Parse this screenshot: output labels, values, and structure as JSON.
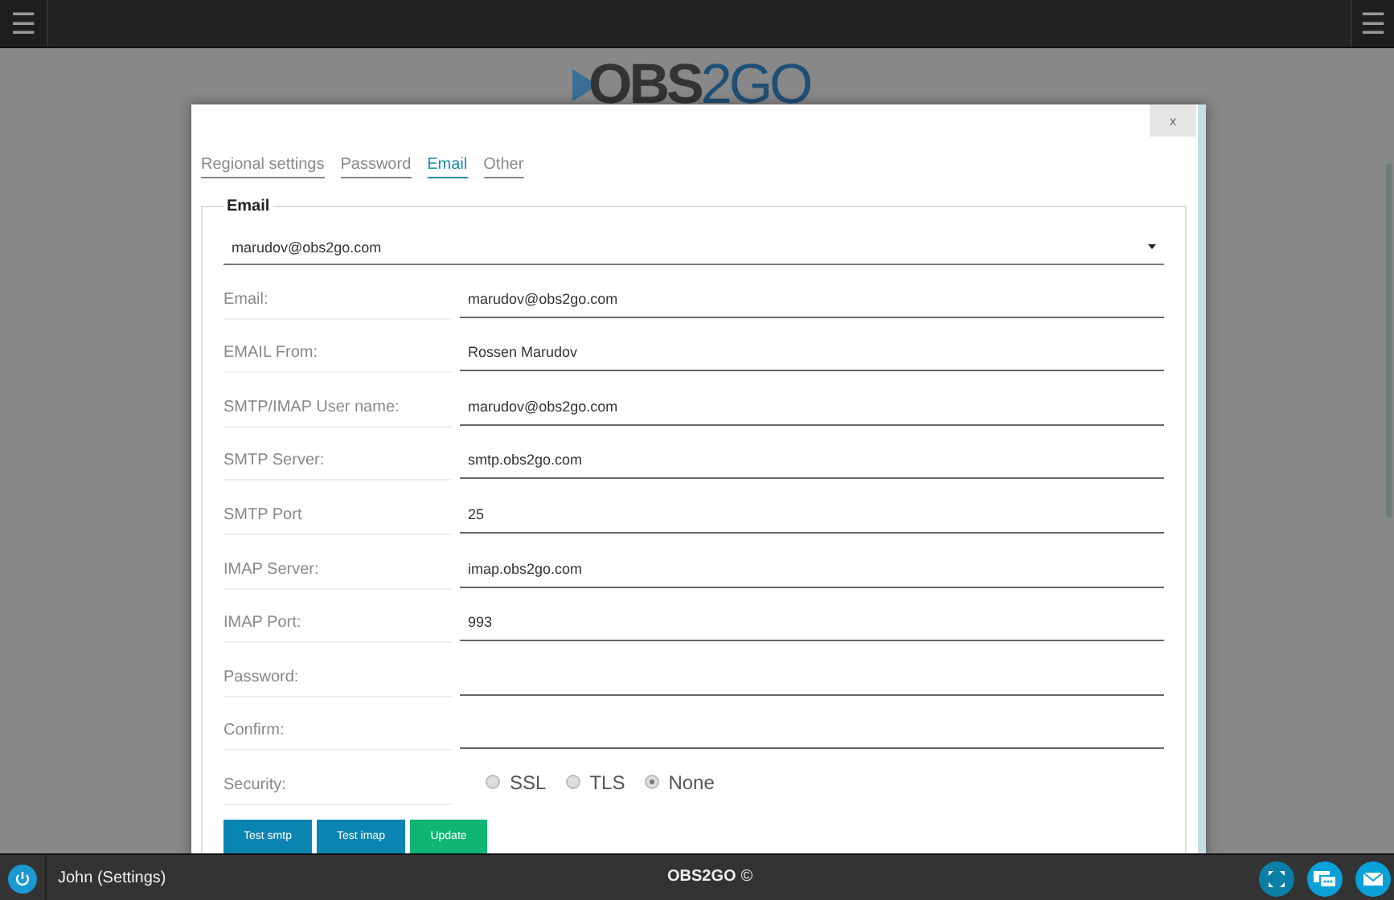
{
  "top_bar": {
    "menu_left": "☰",
    "menu_right": "☰"
  },
  "logo": {
    "part_1": "OBS",
    "part_2": "2GO"
  },
  "dialog": {
    "close": "x",
    "tabs": [
      {
        "label": "Regional settings",
        "selected": false
      },
      {
        "label": "Password",
        "selected": false
      },
      {
        "label": "Email",
        "selected": true
      },
      {
        "label": "Other",
        "selected": false
      }
    ],
    "section": "Email",
    "account_select": {
      "value": "marudov@obs2go.com"
    },
    "fields": [
      {
        "label": "Email:",
        "value": "marudov@obs2go.com"
      },
      {
        "label": "EMAIL From:",
        "value": "Rossen Marudov"
      },
      {
        "label": "SMTP/IMAP User name:",
        "value": "marudov@obs2go.com"
      },
      {
        "label": "SMTP Server:",
        "value": "smtp.obs2go.com"
      },
      {
        "label": "SMTP Port",
        "value": "25"
      },
      {
        "label": "IMAP Server:",
        "value": "imap.obs2go.com"
      },
      {
        "label": "IMAP Port:",
        "value": "993"
      },
      {
        "label": "Password:"
      },
      {
        "label": "Confirm:"
      }
    ],
    "security": {
      "label": "Security:",
      "options": [
        {
          "label": "SSL",
          "selected": false
        },
        {
          "label": "TLS",
          "selected": false
        },
        {
          "label": "None",
          "selected": true
        }
      ]
    },
    "buttons": [
      {
        "label": "Test smtp",
        "kind": "primary"
      },
      {
        "label": "Test imap",
        "kind": "primary"
      },
      {
        "label": "Update",
        "kind": "success"
      }
    ]
  },
  "bottom_bar": {
    "user": "John (Settings)",
    "brand": "OBS2GO",
    "copyright": "©"
  }
}
